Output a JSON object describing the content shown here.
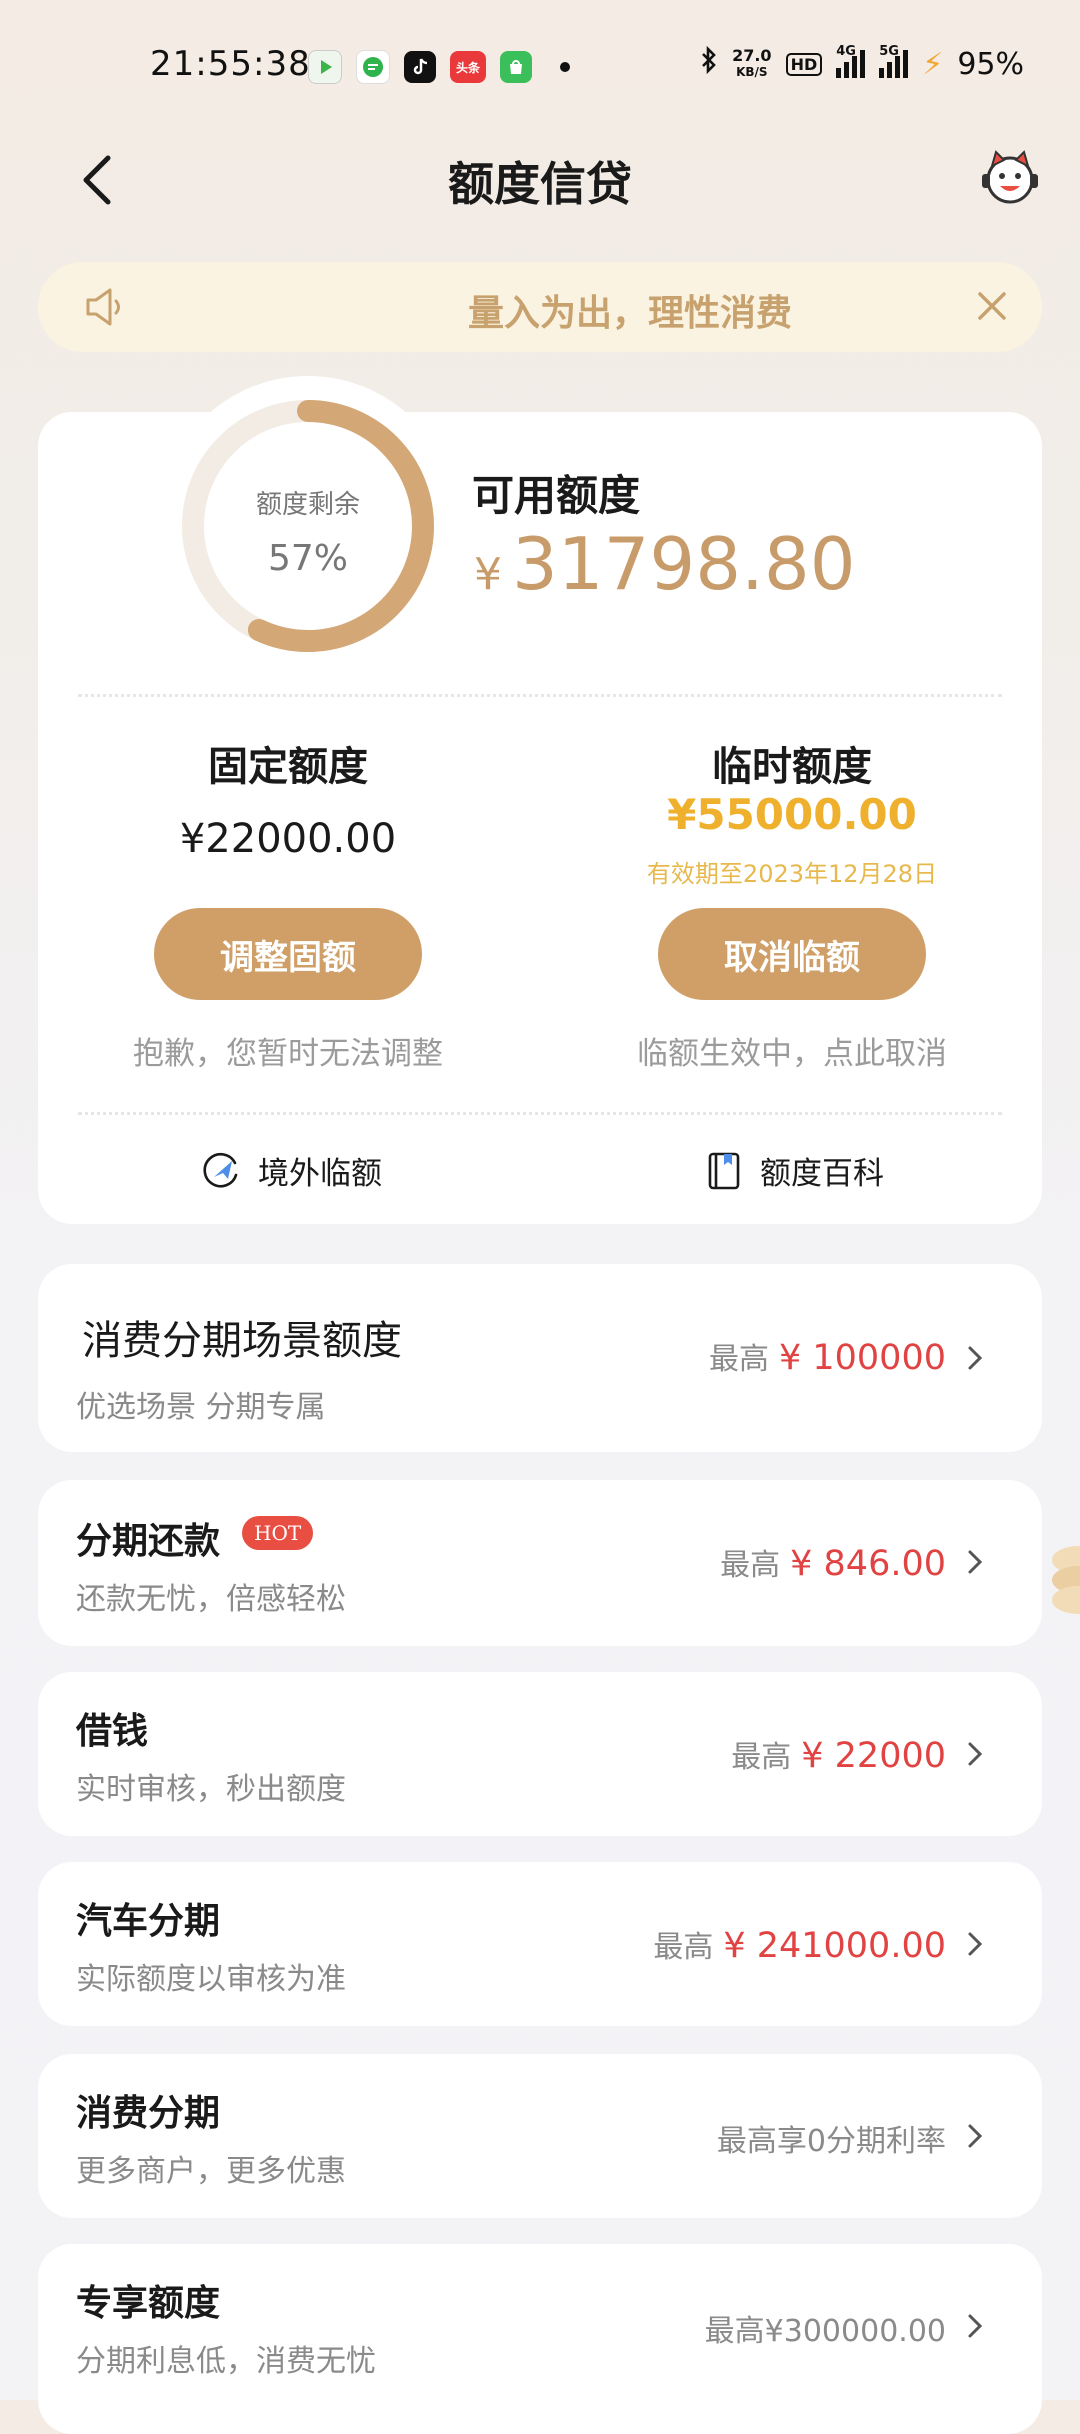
{
  "status_bar": {
    "time": "21:55:38",
    "net_speed_value": "27.0",
    "net_speed_unit": "KB/S",
    "hd": "HD",
    "net_4g": "4G",
    "net_5g": "5G",
    "battery": "95%",
    "app_toutiao": "头条"
  },
  "nav": {
    "title": "额度信贷",
    "icons": [
      "back-arrow-icon",
      "mascot-icon"
    ]
  },
  "notice": {
    "text": "量入为出，理性消费",
    "icons": [
      "speaker-icon",
      "close-icon"
    ]
  },
  "credit": {
    "gauge_label": "额度剩余",
    "gauge_percent_text": "57%",
    "remaining_fraction": 0.57,
    "available_label": "可用额度",
    "currency": "¥",
    "available_amount": "31798.80",
    "fixed": {
      "title": "固定额度",
      "amount": "¥22000.00",
      "button": "调整固额",
      "note": "抱歉，您暂时无法调整"
    },
    "temporary": {
      "title": "临时额度",
      "amount": "¥55000.00",
      "valid_until": "有效期至2023年12月28日",
      "button": "取消临额",
      "note": "临额生效中，点此取消"
    },
    "links": {
      "overseas": "境外临额",
      "wiki": "额度百科"
    }
  },
  "rows": [
    {
      "title": "消费分期场景额度",
      "subtitle": "优选场景 分期专属",
      "prefix": "最高",
      "amount": "¥ 100000"
    },
    {
      "title": "分期还款",
      "badge": "HOT",
      "subtitle": "还款无忧，倍感轻松",
      "prefix": "最高",
      "amount": "¥ 846.00"
    },
    {
      "title": "借钱",
      "subtitle": "实时审核，秒出额度",
      "prefix": "最高",
      "amount": "¥ 22000"
    },
    {
      "title": "汽车分期",
      "subtitle": "实际额度以审核为准",
      "prefix": "最高",
      "amount": "¥ 241000.00"
    },
    {
      "title": "消费分期",
      "subtitle": "更多商户，更多优惠",
      "right_text": "最高享0分期利率"
    },
    {
      "title": "专享额度",
      "subtitle": "分期利息低，消费无忧",
      "right_text": "最高¥300000.00"
    }
  ],
  "colors": {
    "accent_gold": "#cf9f67",
    "amount_red": "#e14343",
    "temp_yellow": "#efb12d",
    "notice_bg": "#fbf3e1"
  }
}
